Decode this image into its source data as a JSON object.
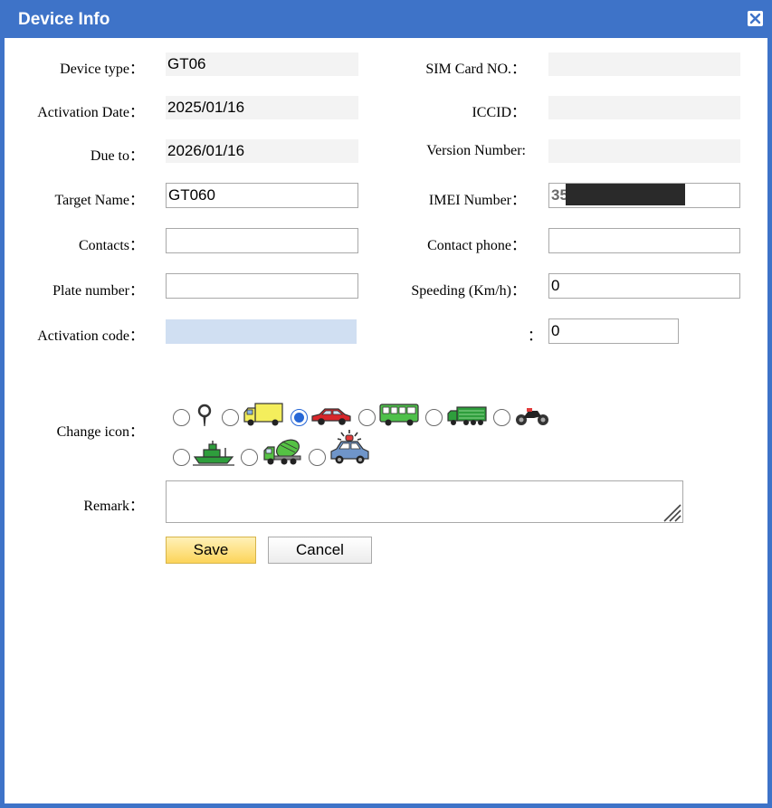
{
  "dialog": {
    "title": "Device Info",
    "close_icon": "close-x-icon"
  },
  "fields": {
    "device_type": {
      "label": "Device type：",
      "value": "GT06"
    },
    "sim_card_no": {
      "label": "SIM Card NO.：",
      "value": ""
    },
    "activation_date": {
      "label": "Activation Date：",
      "value": "2025/01/16"
    },
    "iccid": {
      "label": "ICCID：",
      "value": ""
    },
    "due_to": {
      "label": "Due to：",
      "value": "2026/01/16"
    },
    "version_number": {
      "label": "Version Number:",
      "value": ""
    },
    "target_name": {
      "label": "Target Name：",
      "value": "GT060"
    },
    "imei_number": {
      "label": "IMEI Number：",
      "value": "35"
    },
    "contacts": {
      "label": "Contacts：",
      "value": ""
    },
    "contact_phone": {
      "label": "Contact phone：",
      "value": ""
    },
    "plate_number": {
      "label": "Plate number：",
      "value": ""
    },
    "speeding": {
      "label": "Speeding (Km/h)：",
      "value": "0"
    },
    "activation_code": {
      "label": "Activation code：",
      "value": ""
    },
    "unnamed_field": {
      "label": "：",
      "value": "0"
    }
  },
  "change_icon": {
    "label": "Change icon：",
    "options": [
      {
        "icon": "map-pin-icon",
        "selected": false
      },
      {
        "icon": "truck-icon",
        "selected": false
      },
      {
        "icon": "car-icon",
        "selected": true
      },
      {
        "icon": "bus-icon",
        "selected": false
      },
      {
        "icon": "train-truck-icon",
        "selected": false
      },
      {
        "icon": "motorcycle-icon",
        "selected": false
      },
      {
        "icon": "boat-icon",
        "selected": false
      },
      {
        "icon": "mixer-truck-icon",
        "selected": false
      },
      {
        "icon": "police-car-icon",
        "selected": false
      }
    ]
  },
  "remark": {
    "label": "Remark：",
    "value": ""
  },
  "buttons": {
    "save": "Save",
    "cancel": "Cancel"
  },
  "colors": {
    "titlebar": "#3e73c8",
    "selected_radio": "#2767d6",
    "save_button": "#fcd45a",
    "activation_code_bg": "#d0dff2"
  }
}
